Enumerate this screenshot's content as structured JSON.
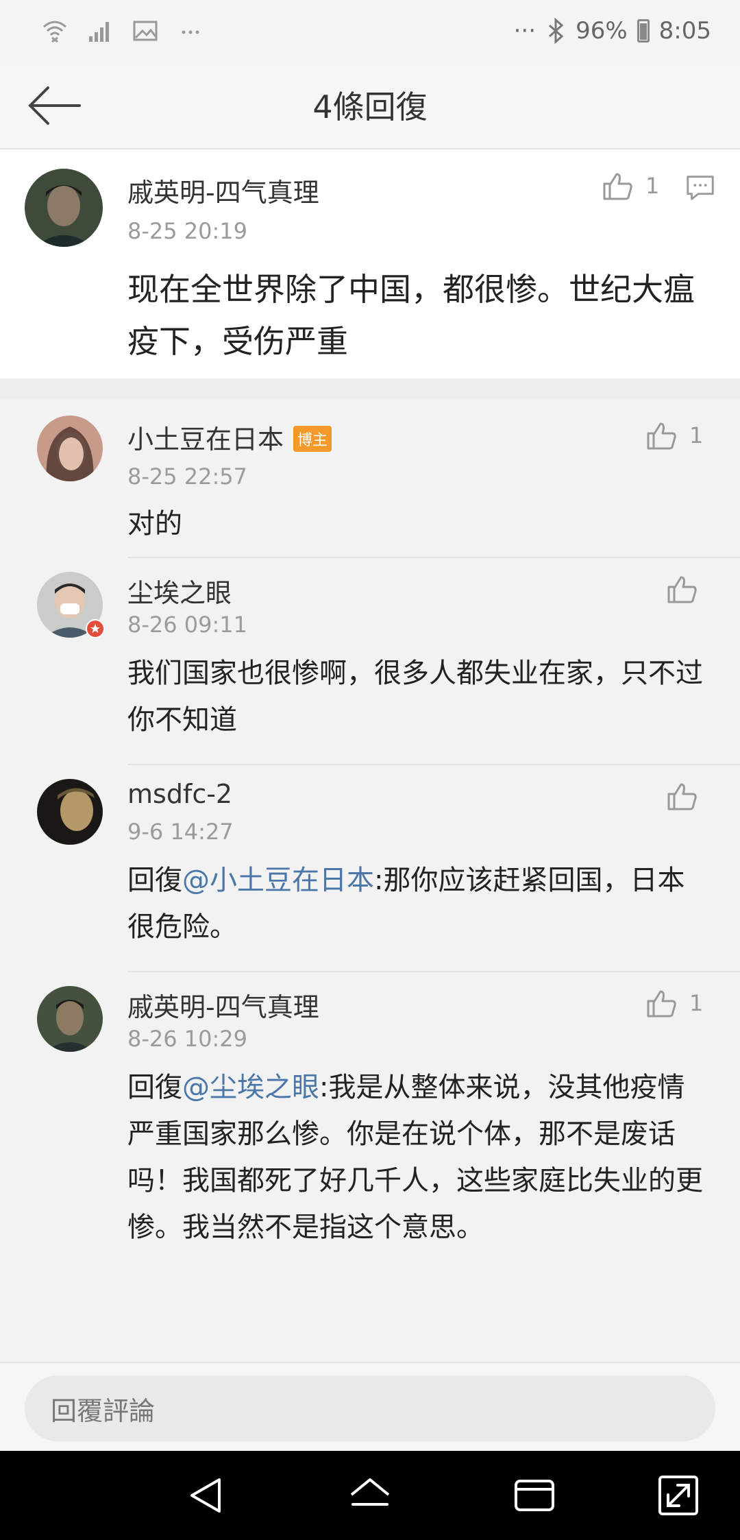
{
  "status_bar": {
    "left_icons": [
      "wifi-icon",
      "signal-icon",
      "image-icon",
      "more-icon"
    ],
    "right_dots": "···",
    "bluetooth": "bluetooth-icon",
    "battery": "96%",
    "time": "8:05"
  },
  "header": {
    "title": "4條回復"
  },
  "main_comment": {
    "username": "戚英明-四气真理",
    "timestamp": "8-25 20:19",
    "likes": "1",
    "text": "现在全世界除了中国，都很惨。世纪大瘟疫下，受伤严重"
  },
  "replies": [
    {
      "username": "小土豆在日本",
      "badge": "博主",
      "timestamp": "8-25 22:57",
      "likes": "1",
      "prefix": "",
      "mention": "",
      "text": "对的"
    },
    {
      "username": "尘埃之眼",
      "timestamp": "8-26 09:11",
      "likes": "",
      "prefix": "",
      "mention": "",
      "text": "我们国家也很惨啊，很多人都失业在家，只不过你不知道"
    },
    {
      "username": "msdfc-2",
      "timestamp": "9-6 14:27",
      "likes": "",
      "prefix": "回復",
      "mention": "@小土豆在日本",
      "text": ":那你应该赶紧回国，日本很危险。"
    },
    {
      "username": "戚英明-四气真理",
      "timestamp": "8-26 10:29",
      "likes": "1",
      "prefix": "回復",
      "mention": "@尘埃之眼",
      "text": ":我是从整体来说，没其他疫情严重国家那么惨。你是在说个体，那不是废话吗！我国都死了好几千人，这些家庭比失业的更惨。我当然不是指这个意思。"
    }
  ],
  "reply_input": {
    "placeholder": "回覆評論"
  },
  "colors": {
    "mention": "#4a76a8",
    "badge": "#f39a2b"
  }
}
